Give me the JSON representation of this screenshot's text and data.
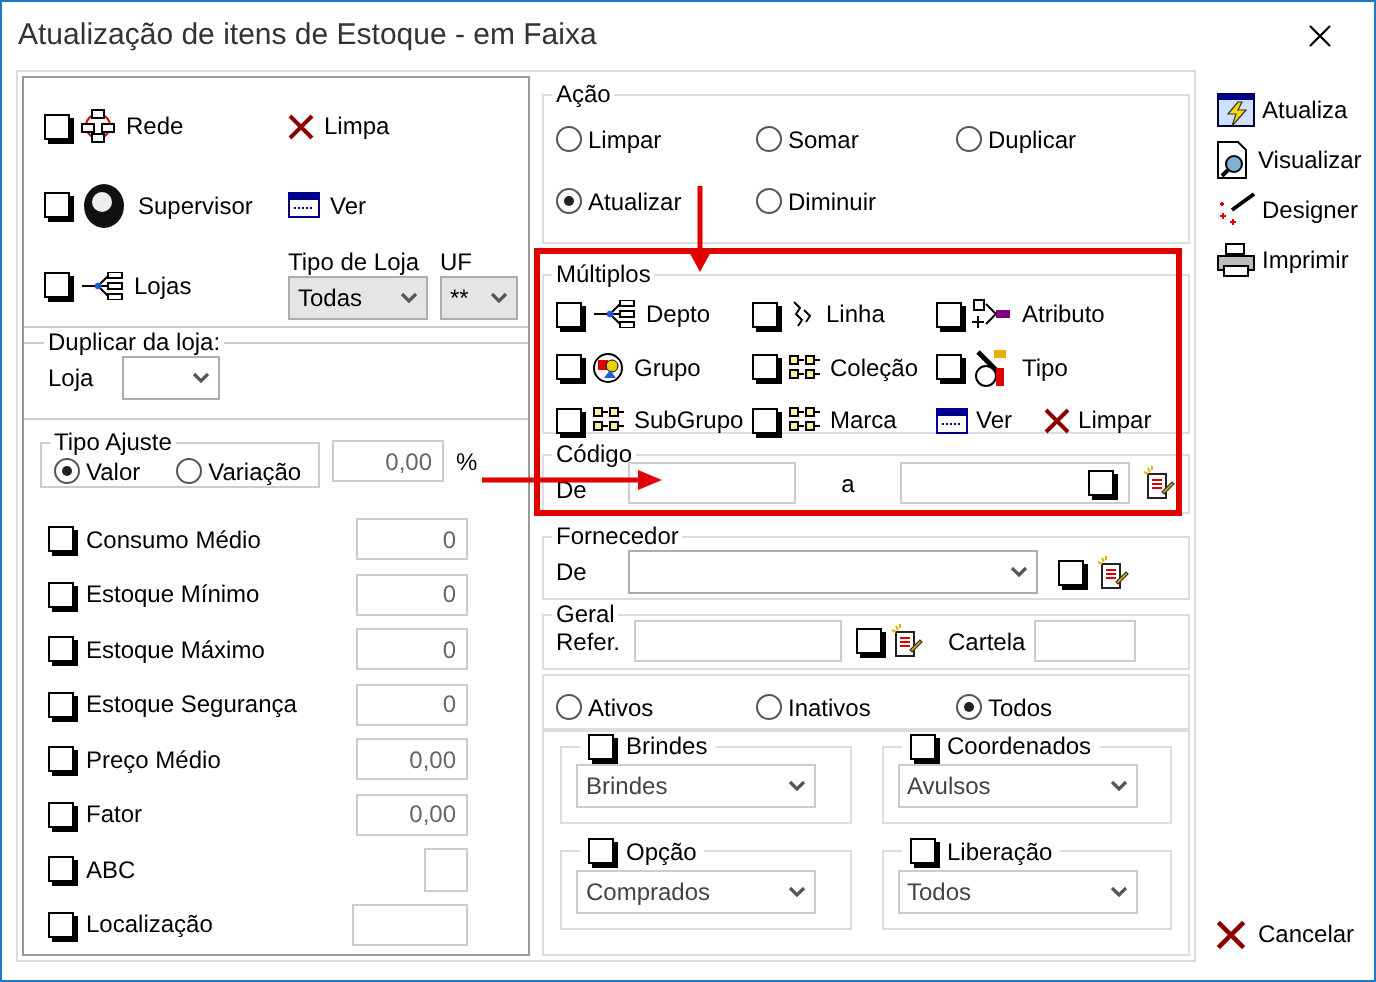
{
  "window": {
    "title": "Atualização de itens de Estoque - em Faixa"
  },
  "scope": {
    "items": [
      {
        "kind": "network",
        "label": "Rede",
        "checked": false
      },
      {
        "kind": "person",
        "label": "Supervisor",
        "checked": false
      },
      {
        "kind": "tree",
        "label": "Lojas",
        "checked": false
      }
    ],
    "clear": "Limpa",
    "view": "Ver",
    "store_type": {
      "label": "Tipo de Loja",
      "value": "Todas"
    },
    "uf": {
      "label": "UF",
      "value": "**"
    }
  },
  "duplicate": {
    "title": "Duplicar da loja:",
    "label": "Loja"
  },
  "adjust": {
    "title": "Tipo Ajuste",
    "options": [
      {
        "label": "Valor",
        "selected": true
      },
      {
        "label": "Variação",
        "selected": false
      }
    ],
    "value": "0,00",
    "unit": "%"
  },
  "fields": [
    {
      "kind": "number",
      "label": "Consumo Médio",
      "checked": false,
      "value": "0"
    },
    {
      "kind": "number",
      "label": "Estoque Mínimo",
      "checked": false,
      "value": "0"
    },
    {
      "kind": "number",
      "label": "Estoque Máximo",
      "checked": false,
      "value": "0"
    },
    {
      "kind": "number",
      "label": "Estoque Segurança",
      "checked": false,
      "value": "0"
    },
    {
      "kind": "number",
      "label": "Preço Médio",
      "checked": false,
      "value": "0,00"
    },
    {
      "kind": "number",
      "label": "Fator",
      "checked": false,
      "value": "0,00"
    },
    {
      "kind": "short",
      "label": "ABC",
      "checked": false
    },
    {
      "kind": "text",
      "label": "Localização",
      "checked": false
    }
  ],
  "action": {
    "title": "Ação",
    "options": [
      {
        "label": "Limpar",
        "selected": false
      },
      {
        "label": "Somar",
        "selected": false
      },
      {
        "label": "Duplicar",
        "selected": false
      },
      {
        "label": "Atualizar",
        "selected": true
      },
      {
        "label": "Diminuir",
        "selected": false
      }
    ]
  },
  "multiple": {
    "title": "Múltiplos",
    "items": [
      {
        "kind": "tree",
        "label": "Depto",
        "checked": false
      },
      {
        "kind": "link",
        "label": "Linha",
        "checked": false
      },
      {
        "kind": "attribute",
        "label": "Atributo",
        "checked": false
      },
      {
        "kind": "group",
        "label": "Grupo",
        "checked": false
      },
      {
        "kind": "grid",
        "label": "Coleção",
        "checked": false
      },
      {
        "kind": "tools",
        "label": "Tipo",
        "checked": false
      },
      {
        "kind": "grid",
        "label": "SubGrupo",
        "checked": false
      },
      {
        "kind": "grid",
        "label": "Marca",
        "checked": false
      }
    ],
    "view": "Ver",
    "clear": "Limpar"
  },
  "code": {
    "title": "Código",
    "from": "De",
    "to": "a",
    "checked": false
  },
  "supplier": {
    "title": "Fornecedor",
    "label": "De",
    "checked": false
  },
  "general": {
    "title": "Geral",
    "ref_label": "Refer.",
    "checked": false,
    "card_label": "Cartela"
  },
  "status": [
    {
      "label": "Ativos",
      "selected": false
    },
    {
      "label": "Inativos",
      "selected": false
    },
    {
      "label": "Todos",
      "selected": true
    }
  ],
  "groups": [
    {
      "label": "Brindes",
      "checked": false,
      "value": "Brindes"
    },
    {
      "label": "Coordenados",
      "checked": false,
      "value": "Avulsos"
    },
    {
      "label": "Opção",
      "checked": false,
      "value": "Comprados"
    },
    {
      "label": "Liberação",
      "checked": false,
      "value": "Todos"
    }
  ],
  "buttons": [
    {
      "kind": "refresh",
      "label": "Atualiza"
    },
    {
      "kind": "preview",
      "label": "Visualizar"
    },
    {
      "kind": "designer",
      "label": "Designer"
    },
    {
      "kind": "print",
      "label": "Imprimir"
    }
  ],
  "cancel": {
    "label": "Cancelar"
  }
}
